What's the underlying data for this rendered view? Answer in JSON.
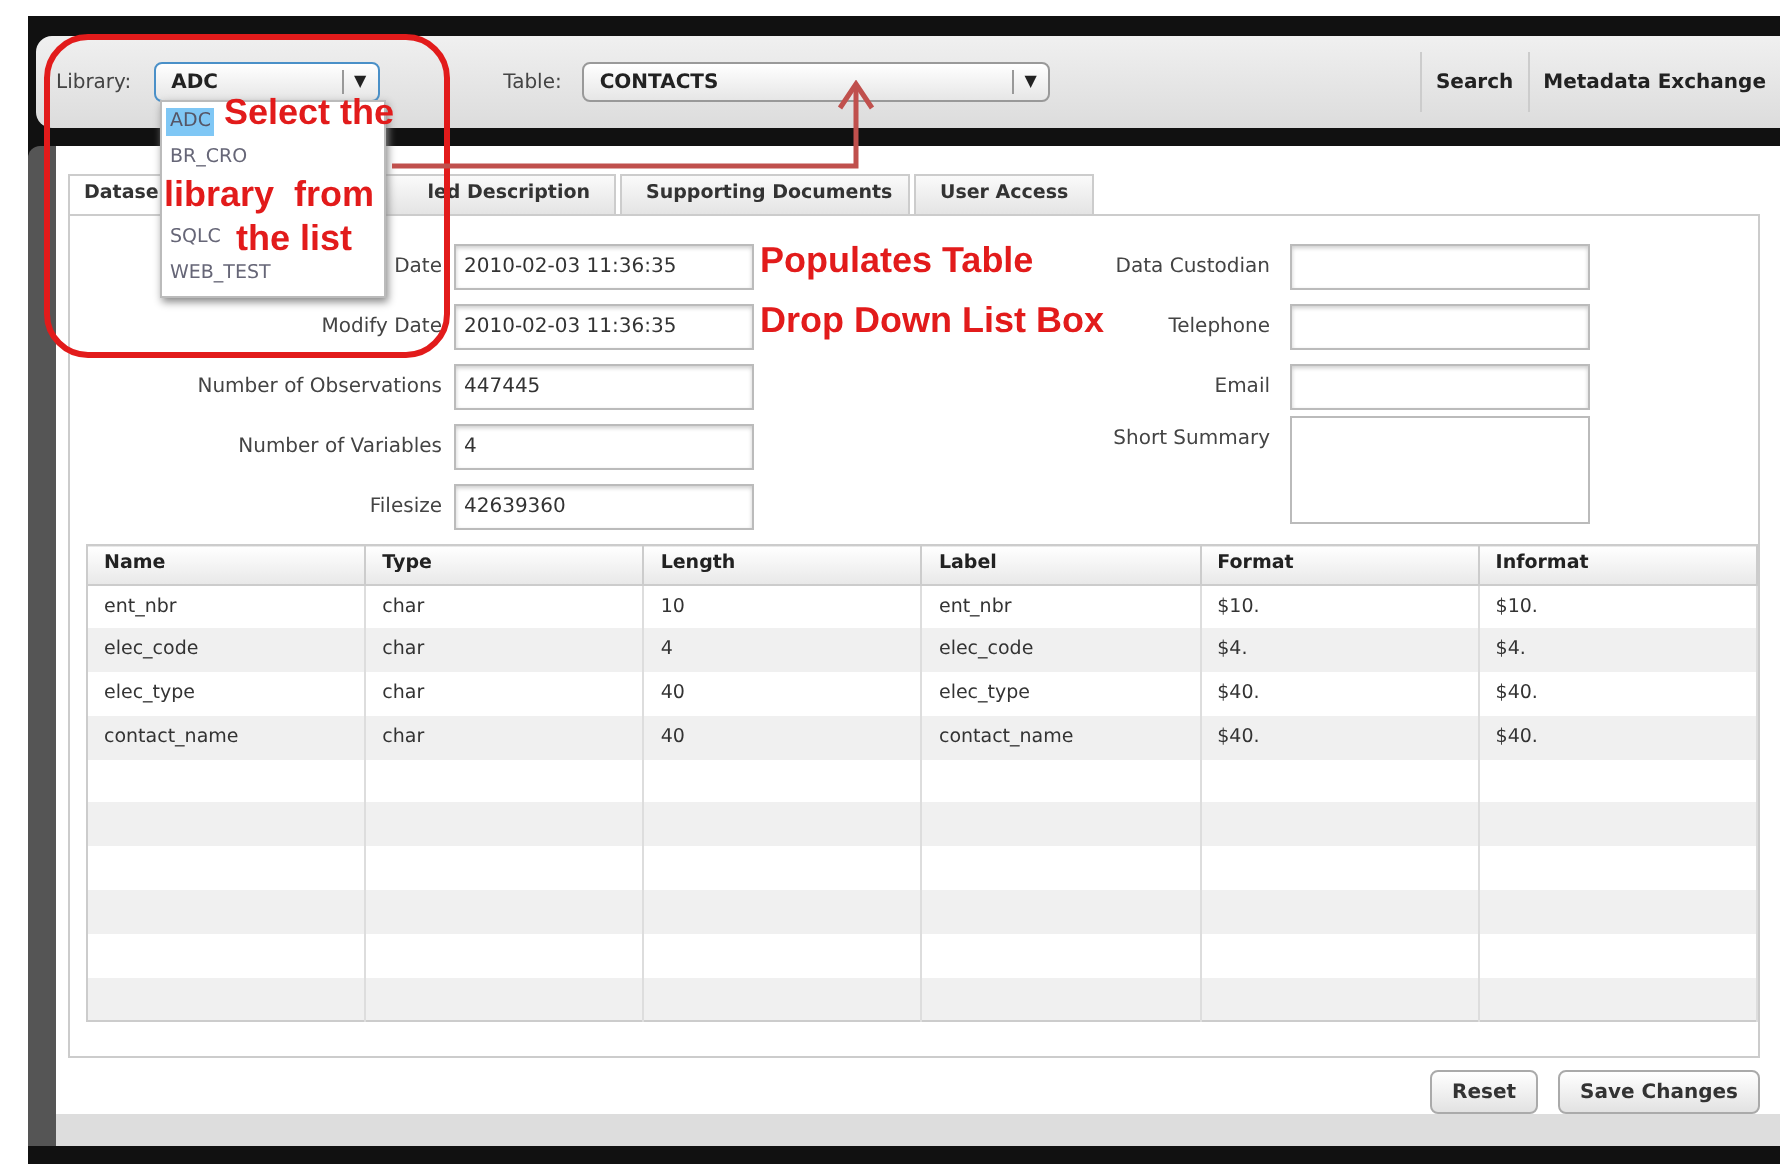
{
  "toolbar": {
    "library": {
      "label": "Library:",
      "value": "ADC",
      "caret": "▼",
      "list": [
        {
          "label": "ADC",
          "selected": true
        },
        {
          "label": "BR_CRO",
          "selected": false
        },
        {
          "label": "SQLC",
          "selected": false
        },
        {
          "label": "WEB_TEST",
          "selected": false
        }
      ]
    },
    "table": {
      "label": "Table:",
      "value": "CONTACTS",
      "caret": "▼"
    },
    "links": [
      "Search",
      "Metadata Exchange"
    ]
  },
  "tabs": [
    {
      "label": "Datase",
      "selected": true
    },
    {
      "label": "led Description",
      "selected": false
    },
    {
      "label": "Supporting Documents",
      "selected": false
    },
    {
      "label": "User Access",
      "selected": false
    }
  ],
  "fields_left": [
    {
      "label": "Date",
      "value": "2010-02-03 11:36:35"
    },
    {
      "label": "Modify Date",
      "value": "2010-02-03 11:36:35"
    },
    {
      "label": "Number of Observations",
      "value": "447445"
    },
    {
      "label": "Number of Variables",
      "value": "4"
    },
    {
      "label": "Filesize",
      "value": "42639360"
    }
  ],
  "fields_right": [
    {
      "label": "Data Custodian",
      "kind": "input"
    },
    {
      "label": "Telephone",
      "kind": "input"
    },
    {
      "label": "Email",
      "kind": "input"
    },
    {
      "label": "Short Summary",
      "kind": "textarea"
    }
  ],
  "table": {
    "columns": [
      "Name",
      "Type",
      "Length",
      "Label",
      "Format",
      "Informat"
    ],
    "rows": [
      [
        "ent_nbr",
        "char",
        "10",
        "ent_nbr",
        "$10.",
        "$10."
      ],
      [
        "elec_code",
        "char",
        "4",
        "elec_code",
        "$4.",
        "$4."
      ],
      [
        "elec_type",
        "char",
        "40",
        "elec_type",
        "$40.",
        "$40."
      ],
      [
        "contact_name",
        "char",
        "40",
        "contact_name",
        "$40.",
        "$40."
      ]
    ]
  },
  "buttons": [
    "Reset",
    "Save Changes"
  ],
  "annotations": [
    {
      "kind": "callout",
      "lines": [
        "Select the",
        "library  from",
        "the list"
      ]
    },
    {
      "kind": "note",
      "lines": [
        "Populates Table",
        "Drop Down List Box"
      ]
    }
  ]
}
